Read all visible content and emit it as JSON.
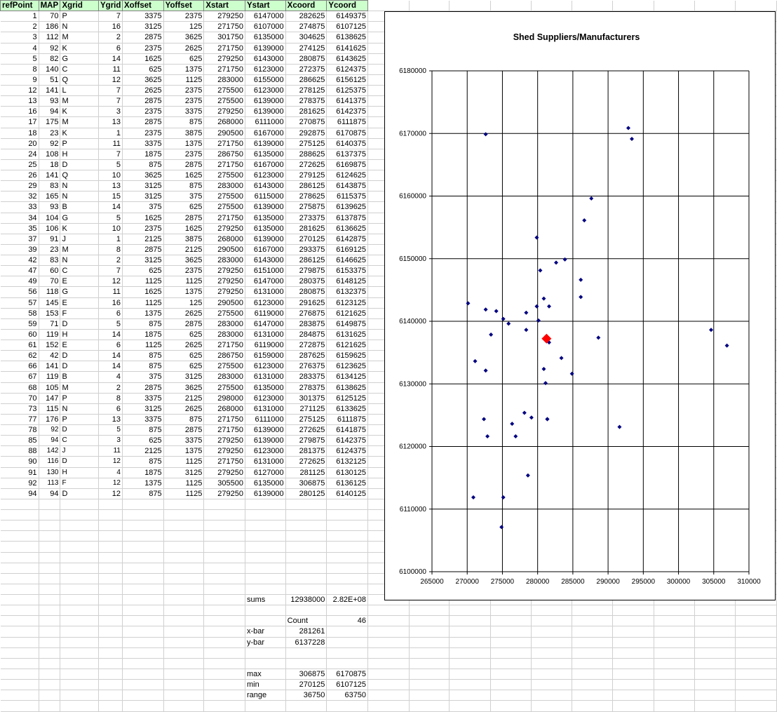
{
  "sheet": {
    "headers": [
      "refPoint",
      "MAP",
      "Xgrid",
      "Ygrid",
      "Xoffset",
      "Yoffset",
      "Xstart",
      "Ystart",
      "Xcoord",
      "Ycoord"
    ],
    "rows": [
      [
        "1",
        "70",
        "P",
        "7",
        "3375",
        "2375",
        "279250",
        "6147000",
        "282625",
        "6149375"
      ],
      [
        "2",
        "186",
        "N",
        "16",
        "3125",
        "125",
        "271750",
        "6107000",
        "274875",
        "6107125"
      ],
      [
        "3",
        "112",
        "M",
        "2",
        "2875",
        "3625",
        "301750",
        "6135000",
        "304625",
        "6138625"
      ],
      [
        "4",
        "92",
        "K",
        "6",
        "2375",
        "2625",
        "271750",
        "6139000",
        "274125",
        "6141625"
      ],
      [
        "5",
        "82",
        "G",
        "14",
        "1625",
        "625",
        "279250",
        "6143000",
        "280875",
        "6143625"
      ],
      [
        "8",
        "140",
        "C",
        "11",
        "625",
        "1375",
        "271750",
        "6123000",
        "272375",
        "6124375"
      ],
      [
        "9",
        "51",
        "Q",
        "12",
        "3625",
        "1125",
        "283000",
        "6155000",
        "286625",
        "6156125"
      ],
      [
        "12",
        "141",
        "L",
        "7",
        "2625",
        "2375",
        "275500",
        "6123000",
        "278125",
        "6125375"
      ],
      [
        "13",
        "93",
        "M",
        "7",
        "2875",
        "2375",
        "275500",
        "6139000",
        "278375",
        "6141375"
      ],
      [
        "16",
        "94",
        "K",
        "3",
        "2375",
        "3375",
        "279250",
        "6139000",
        "281625",
        "6142375"
      ],
      [
        "17",
        "175",
        "M",
        "13",
        "2875",
        "875",
        "268000",
        "6111000",
        "270875",
        "6111875"
      ],
      [
        "18",
        "23",
        "K",
        "1",
        "2375",
        "3875",
        "290500",
        "6167000",
        "292875",
        "6170875"
      ],
      [
        "20",
        "92",
        "P",
        "11",
        "3375",
        "1375",
        "271750",
        "6139000",
        "275125",
        "6140375"
      ],
      [
        "24",
        "108",
        "H",
        "7",
        "1875",
        "2375",
        "286750",
        "6135000",
        "288625",
        "6137375"
      ],
      [
        "25",
        "18",
        "D",
        "5",
        "875",
        "2875",
        "271750",
        "6167000",
        "272625",
        "6169875"
      ],
      [
        "26",
        "141",
        "Q",
        "10",
        "3625",
        "1625",
        "275500",
        "6123000",
        "279125",
        "6124625"
      ],
      [
        "29",
        "83",
        "N",
        "13",
        "3125",
        "875",
        "283000",
        "6143000",
        "286125",
        "6143875"
      ],
      [
        "32",
        "165",
        "N",
        "15",
        "3125",
        "375",
        "275500",
        "6115000",
        "278625",
        "6115375"
      ],
      [
        "33",
        "93",
        "B",
        "14",
        "375",
        "625",
        "275500",
        "6139000",
        "275875",
        "6139625"
      ],
      [
        "34",
        "104",
        "G",
        "5",
        "1625",
        "2875",
        "271750",
        "6135000",
        "273375",
        "6137875"
      ],
      [
        "35",
        "106",
        "K",
        "10",
        "2375",
        "1625",
        "279250",
        "6135000",
        "281625",
        "6136625"
      ],
      [
        "37",
        "91",
        "J",
        "1",
        "2125",
        "3875",
        "268000",
        "6139000",
        "270125",
        "6142875"
      ],
      [
        "39",
        "23",
        "M",
        "8",
        "2875",
        "2125",
        "290500",
        "6167000",
        "293375",
        "6169125"
      ],
      [
        "42",
        "83",
        "N",
        "2",
        "3125",
        "3625",
        "283000",
        "6143000",
        "286125",
        "6146625"
      ],
      [
        "47",
        "60",
        "C",
        "7",
        "625",
        "2375",
        "279250",
        "6151000",
        "279875",
        "6153375"
      ],
      [
        "49",
        "70",
        "E",
        "12",
        "1125",
        "1125",
        "279250",
        "6147000",
        "280375",
        "6148125"
      ],
      [
        "56",
        "118",
        "G",
        "11",
        "1625",
        "1375",
        "279250",
        "6131000",
        "280875",
        "6132375"
      ],
      [
        "57",
        "145",
        "E",
        "16",
        "1125",
        "125",
        "290500",
        "6123000",
        "291625",
        "6123125"
      ],
      [
        "58",
        "153",
        "F",
        "6",
        "1375",
        "2625",
        "275500",
        "6119000",
        "276875",
        "6121625"
      ],
      [
        "59",
        "71",
        "D",
        "5",
        "875",
        "2875",
        "283000",
        "6147000",
        "283875",
        "6149875"
      ],
      [
        "60",
        "119",
        "H",
        "14",
        "1875",
        "625",
        "283000",
        "6131000",
        "284875",
        "6131625"
      ],
      [
        "61",
        "152",
        "E",
        "6",
        "1125",
        "2625",
        "271750",
        "6119000",
        "272875",
        "6121625"
      ],
      [
        "62",
        "42",
        "D",
        "14",
        "875",
        "625",
        "286750",
        "6159000",
        "287625",
        "6159625"
      ],
      [
        "66",
        "141",
        "D",
        "14",
        "875",
        "625",
        "275500",
        "6123000",
        "276375",
        "6123625"
      ],
      [
        "67",
        "119",
        "B",
        "4",
        "375",
        "3125",
        "283000",
        "6131000",
        "283375",
        "6134125"
      ],
      [
        "68",
        "105",
        "M",
        "2",
        "2875",
        "3625",
        "275500",
        "6135000",
        "278375",
        "6138625"
      ],
      [
        "70",
        "147",
        "P",
        "8",
        "3375",
        "2125",
        "298000",
        "6123000",
        "301375",
        "6125125"
      ],
      [
        "73",
        "115",
        "N",
        "6",
        "3125",
        "2625",
        "268000",
        "6131000",
        "271125",
        "6133625"
      ],
      [
        "77",
        "176",
        "P",
        "13",
        "3375",
        "875",
        "271750",
        "6111000",
        "275125",
        "6111875"
      ],
      [
        "78",
        "92",
        "D",
        "5",
        "875",
        "2875",
        "271750",
        "6139000",
        "272625",
        "6141875"
      ],
      [
        "85",
        "94",
        "C",
        "3",
        "625",
        "3375",
        "279250",
        "6139000",
        "279875",
        "6142375"
      ],
      [
        "88",
        "142",
        "J",
        "11",
        "2125",
        "1375",
        "279250",
        "6123000",
        "281375",
        "6124375"
      ],
      [
        "90",
        "116",
        "D",
        "12",
        "875",
        "1125",
        "271750",
        "6131000",
        "272625",
        "6132125"
      ],
      [
        "91",
        "130",
        "H",
        "4",
        "1875",
        "3125",
        "279250",
        "6127000",
        "281125",
        "6130125"
      ],
      [
        "92",
        "113",
        "F",
        "12",
        "1375",
        "1125",
        "305500",
        "6135000",
        "306875",
        "6136125"
      ],
      [
        "94",
        "94",
        "D",
        "12",
        "875",
        "1125",
        "279250",
        "6139000",
        "280125",
        "6140125"
      ]
    ],
    "summary": {
      "sums_label": "sums",
      "sums_x": "12938000",
      "sums_y": "2.82E+08",
      "count_label": "Count",
      "count_value": "46",
      "xbar_label": "x-bar",
      "xbar_value": "281261",
      "ybar_label": "y-bar",
      "ybar_value": "6137228",
      "max_label": "max",
      "max_x": "306875",
      "max_y": "6170875",
      "min_label": "min",
      "min_x": "270125",
      "min_y": "6107125",
      "range_label": "range",
      "range_x": "36750",
      "range_y": "63750"
    }
  },
  "chart_data": {
    "type": "scatter",
    "title": "Shed Suppliers/Manufacturers",
    "xlabel": "",
    "ylabel": "",
    "xlim": [
      265000,
      310000
    ],
    "ylim": [
      6100000,
      6180000
    ],
    "x_ticks": [
      265000,
      270000,
      275000,
      280000,
      285000,
      290000,
      295000,
      300000,
      305000,
      310000
    ],
    "y_ticks": [
      6100000,
      6110000,
      6120000,
      6130000,
      6140000,
      6150000,
      6160000,
      6170000,
      6180000
    ],
    "grid": true,
    "series": [
      {
        "marker": "diamond",
        "color": "#000080",
        "points": [
          [
            282625,
            6149375
          ],
          [
            274875,
            6107125
          ],
          [
            304625,
            6138625
          ],
          [
            274125,
            6141625
          ],
          [
            280875,
            6143625
          ],
          [
            272375,
            6124375
          ],
          [
            286625,
            6156125
          ],
          [
            278125,
            6125375
          ],
          [
            278375,
            6141375
          ],
          [
            281625,
            6142375
          ],
          [
            270875,
            6111875
          ],
          [
            292875,
            6170875
          ],
          [
            275125,
            6140375
          ],
          [
            288625,
            6137375
          ],
          [
            272625,
            6169875
          ],
          [
            279125,
            6124625
          ],
          [
            286125,
            6143875
          ],
          [
            278625,
            6115375
          ],
          [
            275875,
            6139625
          ],
          [
            273375,
            6137875
          ],
          [
            281625,
            6136625
          ],
          [
            270125,
            6142875
          ],
          [
            293375,
            6169125
          ],
          [
            286125,
            6146625
          ],
          [
            279875,
            6153375
          ],
          [
            280375,
            6148125
          ],
          [
            280875,
            6132375
          ],
          [
            291625,
            6123125
          ],
          [
            276875,
            6121625
          ],
          [
            283875,
            6149875
          ],
          [
            284875,
            6131625
          ],
          [
            272875,
            6121625
          ],
          [
            287625,
            6159625
          ],
          [
            276375,
            6123625
          ],
          [
            283375,
            6134125
          ],
          [
            278375,
            6138625
          ],
          [
            281375,
            6124375
          ],
          [
            271125,
            6133625
          ],
          [
            275125,
            6111875
          ],
          [
            272625,
            6141875
          ],
          [
            279875,
            6142375
          ],
          [
            281375,
            6124375
          ],
          [
            272625,
            6132125
          ],
          [
            281125,
            6130125
          ],
          [
            306875,
            6136125
          ],
          [
            280125,
            6140125
          ]
        ]
      },
      {
        "marker": "diamond-large",
        "color": "#ff0000",
        "points": [
          [
            281261,
            6137228
          ]
        ]
      }
    ]
  }
}
